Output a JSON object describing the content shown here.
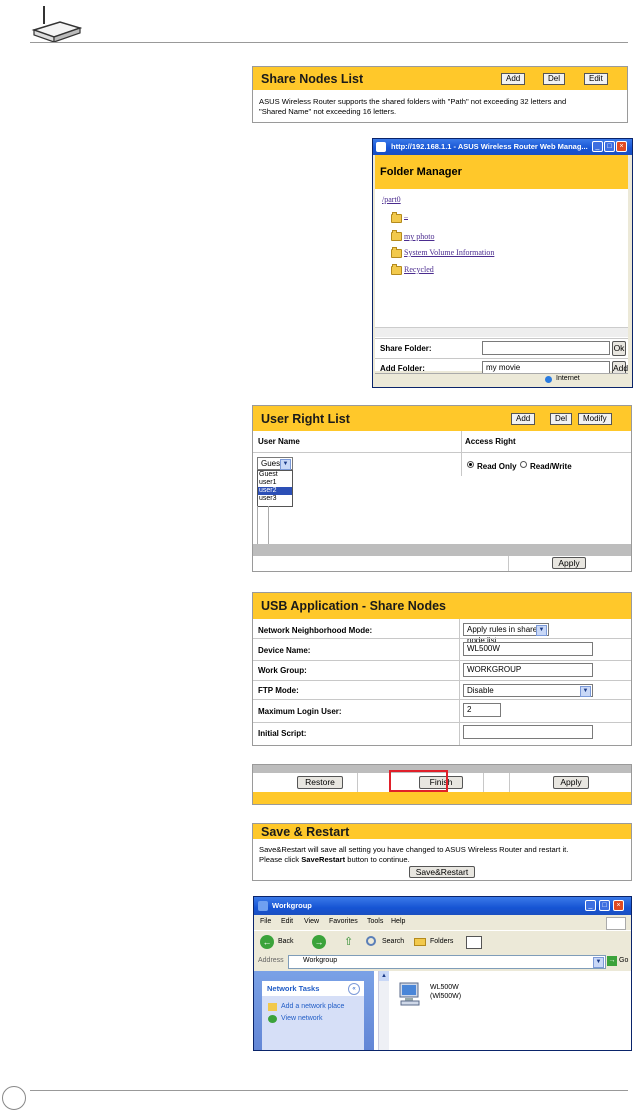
{
  "share_nodes": {
    "title": "Share Nodes List",
    "add": "Add",
    "del": "Del",
    "edit": "Edit",
    "note_line1": "ASUS Wireless Router supports the shared folders with \"Path\" not exceeding 32 letters and",
    "note_line2": "\"Shared Name\" not exceeding 16 letters."
  },
  "folder_manager": {
    "window_title": "http://192.168.1.1 - ASUS Wireless Router Web Manag...",
    "title": "Folder Manager",
    "root": "/part0",
    "folders": [
      "..",
      "my photo",
      "System Volume Information",
      "Recycled"
    ],
    "share_folder_label": "Share Folder:",
    "share_folder_value": "",
    "ok": "Ok",
    "add_folder_label": "Add Folder:",
    "add_folder_value": "my movie",
    "add": "Add",
    "status_internet": "Internet"
  },
  "user_right": {
    "title": "User Right List",
    "add": "Add",
    "del": "Del",
    "modify": "Modify",
    "col_user": "User Name",
    "col_access": "Access Right",
    "selected_user": "Guest",
    "users": [
      "Guest",
      "user1",
      "user2",
      "user3"
    ],
    "highlighted_user": "user2",
    "read_only": "Read Only",
    "read_write": "Read/Write",
    "apply": "Apply"
  },
  "usb_app": {
    "title": "USB Application - Share Nodes",
    "rows": [
      {
        "label": "Network Neighborhood Mode:",
        "value": "Apply rules in shared node list"
      },
      {
        "label": "Device Name:",
        "value": "WL500W"
      },
      {
        "label": "Work Group:",
        "value": "WORKGROUP"
      },
      {
        "label": "FTP Mode:",
        "value": "Disable"
      },
      {
        "label": "Maximum Login User:",
        "value": "2"
      },
      {
        "label": "Initial Script:",
        "value": ""
      }
    ]
  },
  "action_bar": {
    "restore": "Restore",
    "finish": "Finish",
    "apply": "Apply"
  },
  "save_restart": {
    "title": "Save & Restart",
    "line1": "Save&Restart will save all setting you have changed to ASUS Wireless Router and restart it.",
    "line2_pre": "Please click ",
    "line2_bold": "SaveRestart",
    "line2_post": " button to continue.",
    "button": "Save&Restart"
  },
  "workgroup": {
    "window_title": "Workgroup",
    "menu": [
      "File",
      "Edit",
      "View",
      "Favorites",
      "Tools",
      "Help"
    ],
    "back": "Back",
    "search": "Search",
    "folders": "Folders",
    "address_label": "Address",
    "address_value": "Workgroup",
    "go": "Go",
    "network_tasks": "Network Tasks",
    "task1": "Add a network place",
    "task2": "View network",
    "device_line1": "WL500W",
    "device_line2": "(Wl500W)"
  },
  "colors": {
    "accent_yellow": "#ffc82a",
    "xp_blue": "#1654d4",
    "highlight_red": "#e0202a"
  }
}
